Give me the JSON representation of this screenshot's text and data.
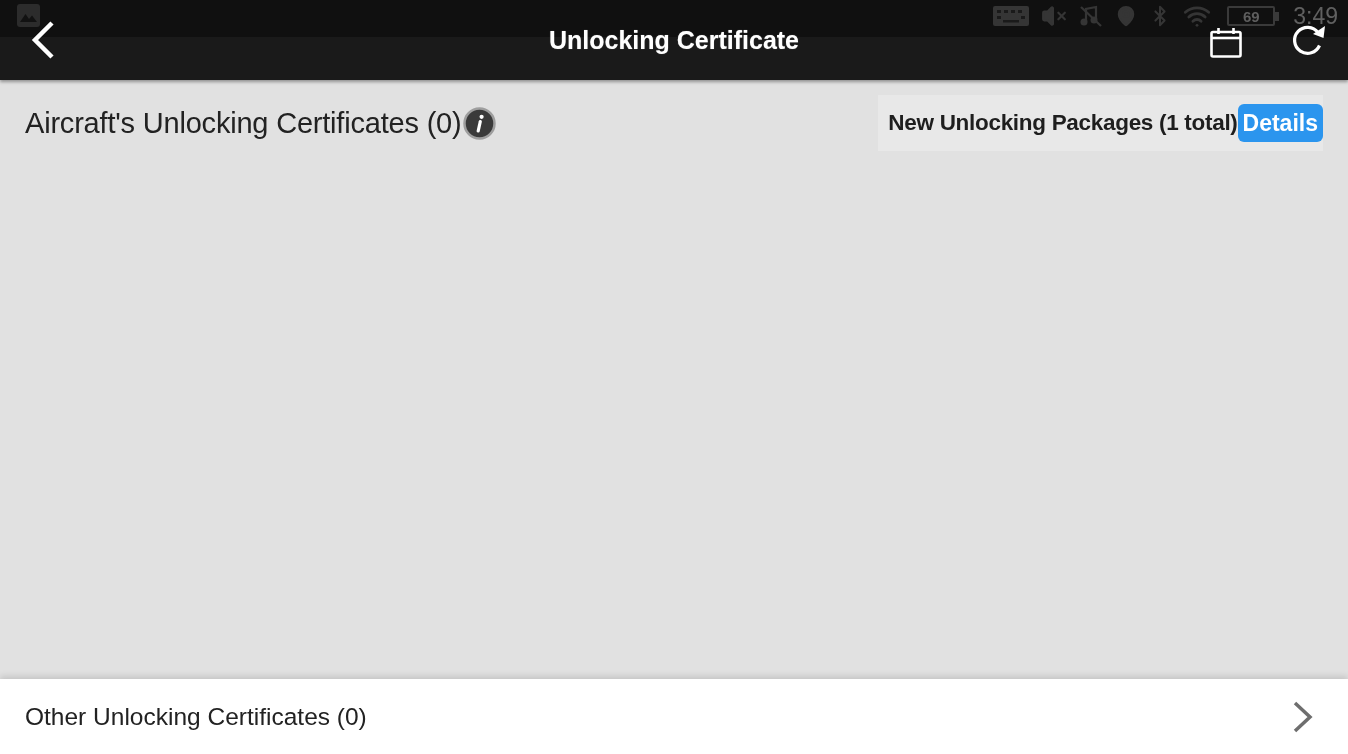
{
  "status_bar": {
    "battery": "69",
    "time": "3:49"
  },
  "header": {
    "title": "Unlocking Certificate"
  },
  "aircraft_certificates": {
    "title": "Aircraft's Unlocking Certificates (0)",
    "packages_notice": "New Unlocking Packages (1 total)",
    "details_button": "Details"
  },
  "other_certificates": {
    "label": "Other Unlocking Certificates (0)"
  }
}
